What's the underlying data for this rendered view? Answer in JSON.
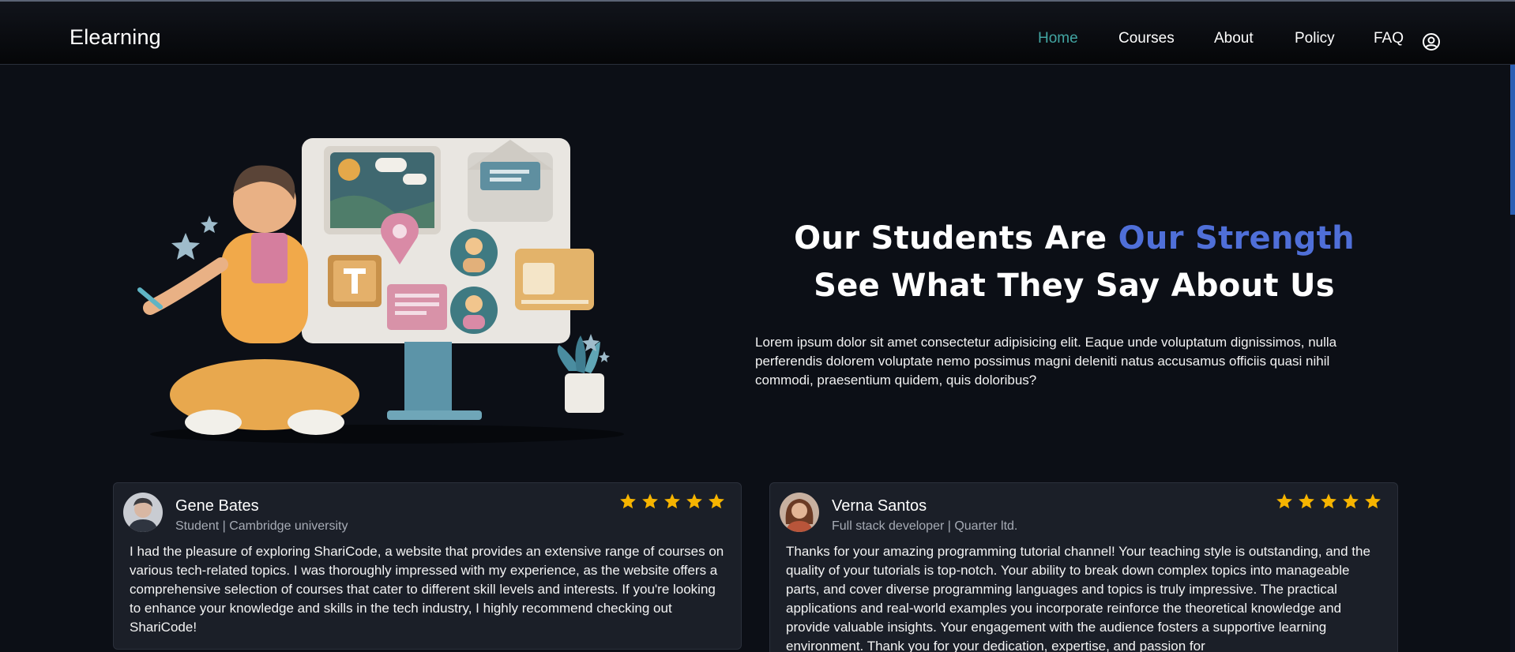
{
  "brand": "Elearning",
  "nav": {
    "items": [
      {
        "label": "Home",
        "active": true
      },
      {
        "label": "Courses",
        "active": false
      },
      {
        "label": "About",
        "active": false
      },
      {
        "label": "Policy",
        "active": false
      },
      {
        "label": "FAQ",
        "active": false
      }
    ],
    "user_icon": "user-circle-icon"
  },
  "hero": {
    "title_part1": "Our Students Are ",
    "title_accent": "Our Strength",
    "title_line2": "See What They Say About Us",
    "paragraph": "Lorem ipsum dolor sit amet consectetur adipisicing elit. Eaque unde voluptatum dignissimos, nulla perferendis dolorem voluptate nemo possimus magni deleniti natus accusamus officiis quasi nihil commodi, praesentium quidem, quis doloribus?"
  },
  "colors": {
    "accent_nav": "#42a5a2",
    "accent_title": "#4f6fd8",
    "star": "#f6b400",
    "background": "#0c0f16",
    "card": "#1b1f28"
  },
  "testimonials": [
    {
      "name": "Gene Bates",
      "role": "Student | Cambridge university",
      "rating": 5,
      "text": "I had the pleasure of exploring ShariCode, a website that provides an extensive range of courses on various tech-related topics. I was thoroughly impressed with my experience, as the website offers a comprehensive selection of courses that cater to different skill levels and interests. If you're looking to enhance your knowledge and skills in the tech industry, I highly recommend checking out ShariCode!"
    },
    {
      "name": "Verna Santos",
      "role": "Full stack developer | Quarter ltd.",
      "rating": 5,
      "text": "Thanks for your amazing programming tutorial channel! Your teaching style is outstanding, and the quality of your tutorials is top-notch. Your ability to break down complex topics into manageable parts, and cover diverse programming languages and topics is truly impressive. The practical applications and real-world examples you incorporate reinforce the theoretical knowledge and provide valuable insights. Your engagement with the audience fosters a supportive learning environment. Thank you for your dedication, expertise, and passion for"
    }
  ]
}
